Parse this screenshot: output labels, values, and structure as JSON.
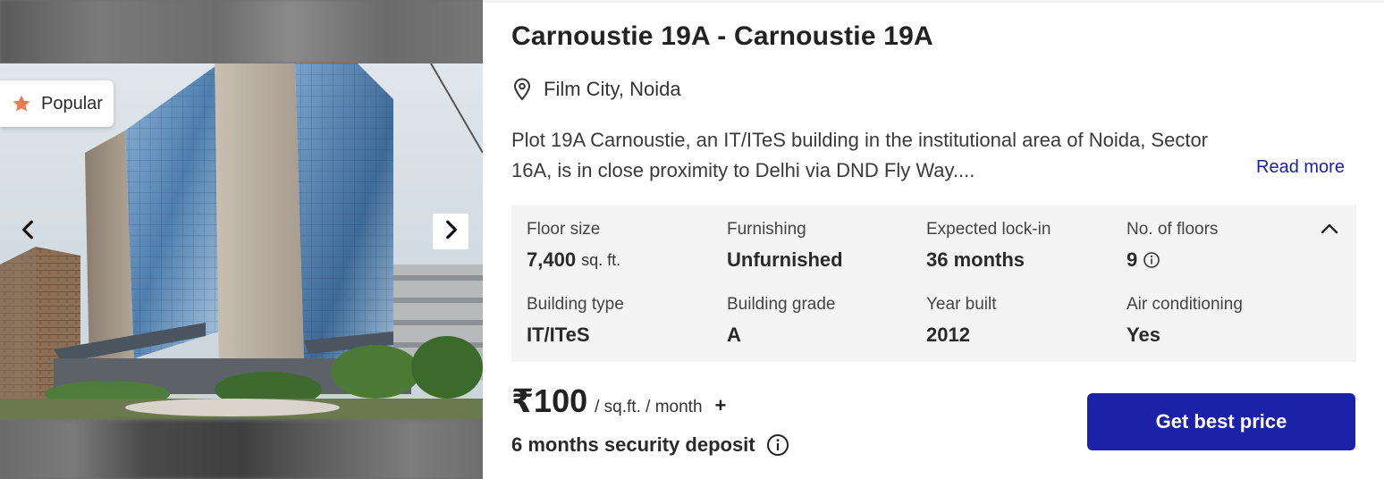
{
  "listing": {
    "title": "Carnoustie 19A - Carnoustie 19A",
    "location": "Film City, Noida",
    "location_icon": "map-pin-icon",
    "description": "Plot 19A Carnoustie, an IT/ITeS building in the institutional area of Noida, Sector 16A, is in close proximity to Delhi via DND Fly Way....",
    "read_more": "Read more"
  },
  "media": {
    "badge_label": "Popular",
    "badge_icon": "star-icon",
    "badge_icon_color": "#f07a55",
    "prev_icon": "chevron-left-icon",
    "next_icon": "chevron-right-icon"
  },
  "specs": {
    "floor_size": {
      "label": "Floor size",
      "value": "7,400",
      "unit": "sq. ft."
    },
    "furnishing": {
      "label": "Furnishing",
      "value": "Unfurnished"
    },
    "lock_in": {
      "label": "Expected lock-in",
      "value": "36 months"
    },
    "floors": {
      "label": "No. of floors",
      "value": "9"
    },
    "building_type": {
      "label": "Building type",
      "value": "IT/ITeS"
    },
    "building_grade": {
      "label": "Building grade",
      "value": "A"
    },
    "year_built": {
      "label": "Year built",
      "value": "2012"
    },
    "air_conditioning": {
      "label": "Air conditioning",
      "value": "Yes"
    },
    "collapse_icon": "chevron-up-icon"
  },
  "pricing": {
    "price": "₹100",
    "unit": "/ sq.ft. / month",
    "plus": "+",
    "deposit": "6 months security deposit",
    "cta": "Get best price",
    "cta_color": "#1c22a8"
  }
}
